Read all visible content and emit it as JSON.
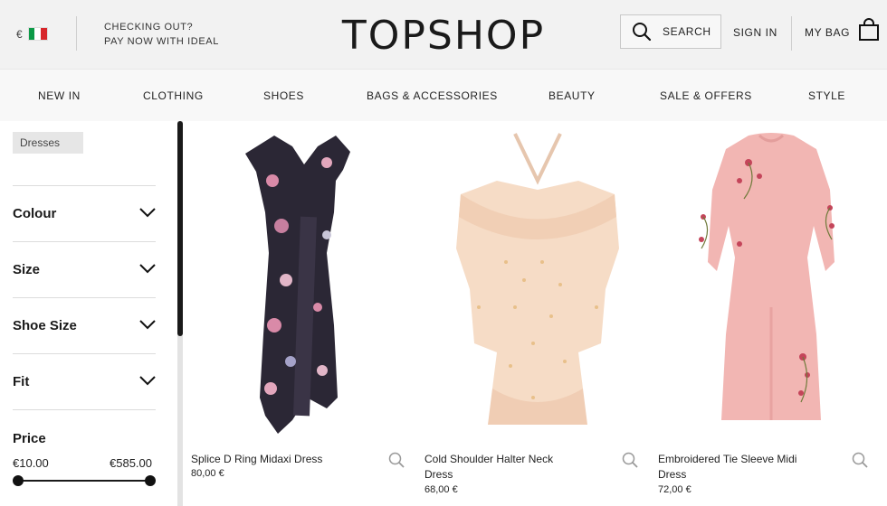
{
  "header": {
    "currency_symbol": "€",
    "promo_line1": "CHECKING OUT?",
    "promo_line2": "PAY NOW WITH IDEAL",
    "logo": "TOPSHOP",
    "search_label": "SEARCH",
    "signin_label": "SIGN IN",
    "bag_label": "MY BAG"
  },
  "nav": {
    "items": [
      "NEW IN",
      "CLOTHING",
      "SHOES",
      "BAGS & ACCESSORIES",
      "BEAUTY",
      "SALE & OFFERS",
      "STYLE"
    ]
  },
  "sidebar": {
    "selected_chip": "Dresses",
    "filters": [
      "Colour",
      "Size",
      "Shoe Size",
      "Fit"
    ],
    "price": {
      "title": "Price",
      "min_label": "€10.00",
      "max_label": "€585.00"
    }
  },
  "products": [
    {
      "name": "Splice D Ring Midaxi Dress",
      "price": "80,00 €"
    },
    {
      "name_line1": "Cold Shoulder Halter Neck",
      "name_line2": "Dress",
      "price": "68,00 €"
    },
    {
      "name_line1": "Embroidered Tie Sleeve Midi",
      "name_line2": "Dress",
      "price": "72,00 €"
    }
  ],
  "colors": {
    "flag_green": "#0c9a47",
    "flag_white": "#ffffff",
    "flag_red": "#d7262b",
    "dress1_base": "#2b2735",
    "dress2_base": "#f6dcc6",
    "dress3_base": "#f2b6b3"
  }
}
